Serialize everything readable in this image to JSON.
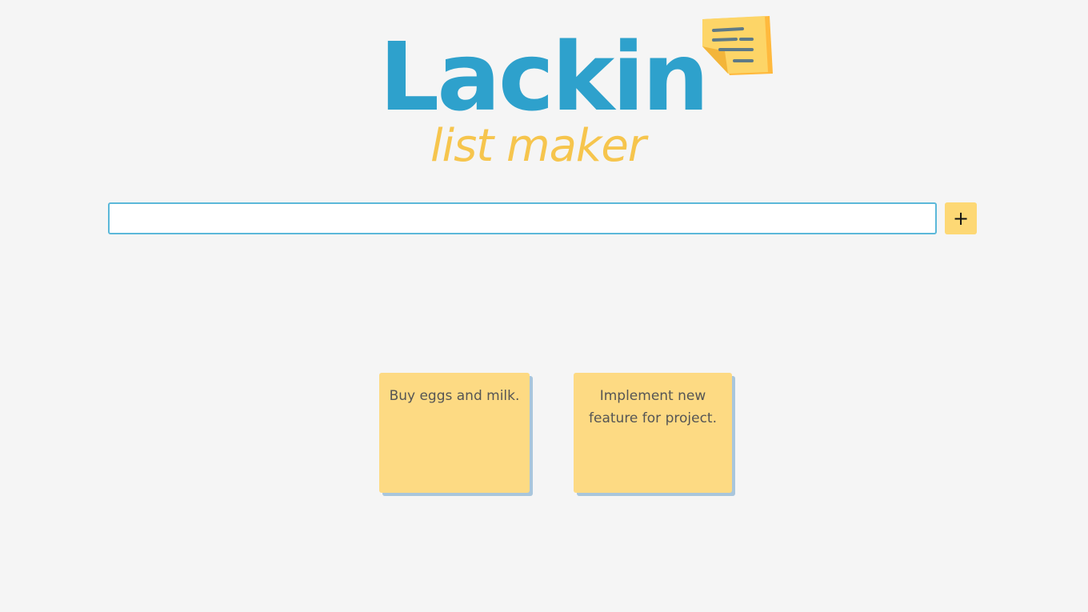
{
  "logo": {
    "title": "Lackin",
    "subtitle": "list maker",
    "icon": "sticky-note-icon"
  },
  "add_bar": {
    "input_value": "",
    "input_placeholder": "",
    "add_button_label": "+"
  },
  "notes": [
    {
      "text": "Buy eggs and milk."
    },
    {
      "text": "Implement new feature for project."
    }
  ],
  "colors": {
    "background": "#f5f5f5",
    "brand_blue": "#2ea1cc",
    "brand_yellow": "#f6c54d",
    "note_yellow": "#fdda83",
    "note_shadow": "#a9c6dc",
    "input_border": "#5bb8d9",
    "button_yellow": "#fdd875"
  }
}
